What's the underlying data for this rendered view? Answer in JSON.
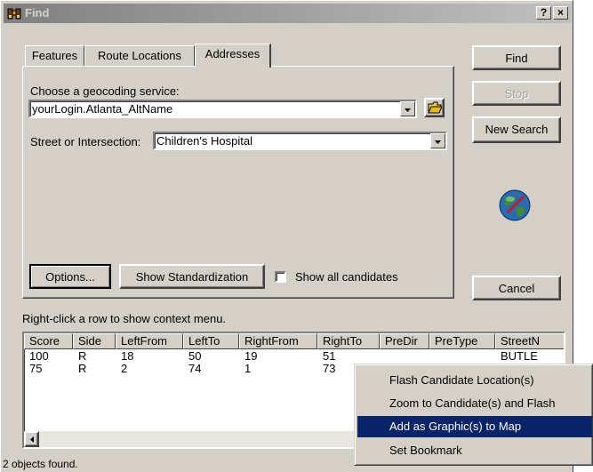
{
  "window": {
    "title": "Find",
    "help_btn": "?",
    "close_btn": "×"
  },
  "tabs": [
    {
      "label": "Features"
    },
    {
      "label": "Route Locations"
    },
    {
      "label": "Addresses"
    }
  ],
  "panel": {
    "geocoding_label": "Choose a geocoding service:",
    "geocoding_value": "yourLogin.Atlanta_AltName",
    "street_label": "Street or Intersection:",
    "street_value": "Children's Hospital",
    "options_btn": "Options...",
    "show_std_btn": "Show Standardization",
    "show_all_label": "Show all candidates",
    "show_all_checked": false
  },
  "side_buttons": {
    "find": "Find",
    "stop": "Stop",
    "new_search": "New Search",
    "cancel": "Cancel"
  },
  "hint": "Right-click a row to show context menu.",
  "table": {
    "columns": [
      "Score",
      "Side",
      "LeftFrom",
      "LeftTo",
      "RightFrom",
      "RightTo",
      "PreDir",
      "PreType",
      "StreetN"
    ],
    "rows": [
      [
        "100",
        "R",
        "18",
        "50",
        "19",
        "51",
        "",
        "",
        "BUTLE"
      ],
      [
        "75",
        "R",
        "2",
        "74",
        "1",
        "73",
        "",
        "",
        ""
      ]
    ]
  },
  "status": "2 objects found.",
  "context_menu": [
    {
      "label": "Flash Candidate Location(s)",
      "highlighted": false
    },
    {
      "label": "Zoom to Candidate(s) and Flash",
      "highlighted": false
    },
    {
      "label": "Add as Graphic(s) to Map",
      "highlighted": true
    },
    {
      "label": "Set Bookmark",
      "highlighted": false
    }
  ],
  "colors": {
    "face": "#d4d0c8",
    "highlight": "#0a246a",
    "titlebar_inactive": "#808080"
  }
}
